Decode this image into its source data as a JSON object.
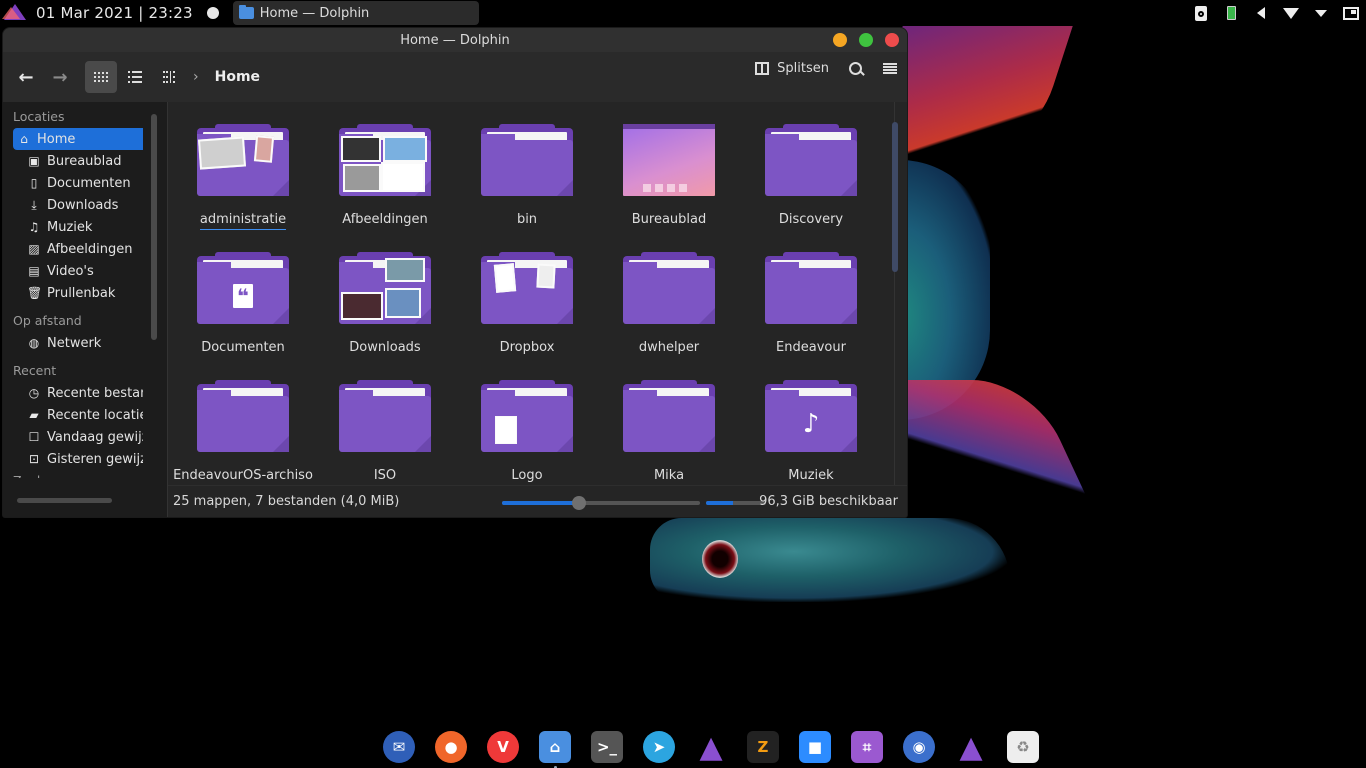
{
  "top_panel": {
    "clock": "01 Mar 2021 | 23:23",
    "task": {
      "label": "Home — Dolphin"
    },
    "tray": [
      "disk-icon",
      "battery-icon",
      "volume-icon",
      "wifi-icon",
      "tray-expand-icon",
      "show-desktop-icon"
    ]
  },
  "window": {
    "title": "Home — Dolphin",
    "buttons": {
      "minimize_color": "#f5a623",
      "maximize_color": "#3fc33f",
      "close_color": "#ee4c4c"
    },
    "toolbar": {
      "back_glyph": "←",
      "forward_glyph": "→",
      "breadcrumb_sep": "›",
      "breadcrumb": "Home",
      "split_label": "Splitsen"
    },
    "sidebar": {
      "sections": [
        {
          "title": "Locaties",
          "items": [
            {
              "label": "Home",
              "icon": "home-icon",
              "glyph": "⌂",
              "active": true
            },
            {
              "label": "Bureaublad",
              "icon": "desktop-icon",
              "glyph": "▣"
            },
            {
              "label": "Documenten",
              "icon": "document-icon",
              "glyph": "▯"
            },
            {
              "label": "Downloads",
              "icon": "download-icon",
              "glyph": "⤓"
            },
            {
              "label": "Muziek",
              "icon": "music-icon",
              "glyph": "♫"
            },
            {
              "label": "Afbeeldingen",
              "icon": "image-icon",
              "glyph": "▨"
            },
            {
              "label": "Video's",
              "icon": "video-icon",
              "glyph": "▤"
            },
            {
              "label": "Prullenbak",
              "icon": "trash-icon",
              "glyph": "🗑"
            }
          ]
        },
        {
          "title": "Op afstand",
          "items": [
            {
              "label": "Netwerk",
              "icon": "network-icon",
              "glyph": "◍"
            }
          ]
        },
        {
          "title": "Recent",
          "items": [
            {
              "label": "Recente bestanden",
              "icon": "clock-icon",
              "glyph": "◷"
            },
            {
              "label": "Recente locaties",
              "icon": "recent-folder-icon",
              "glyph": "▰"
            },
            {
              "label": "Vandaag gewijzigd",
              "icon": "calendar-today-icon",
              "glyph": "☐"
            },
            {
              "label": "Gisteren gewijzigd",
              "icon": "calendar-yesterday-icon",
              "glyph": "⊡"
            }
          ]
        }
      ],
      "cut_section": "Zoeken"
    },
    "files": [
      {
        "name": "administratie",
        "kind": "folder-docs",
        "focused": true
      },
      {
        "name": "Afbeeldingen",
        "kind": "folder-pictures"
      },
      {
        "name": "bin",
        "kind": "folder"
      },
      {
        "name": "Bureaublad",
        "kind": "desktop"
      },
      {
        "name": "Discovery",
        "kind": "folder"
      },
      {
        "name": "Documenten",
        "kind": "folder-quote"
      },
      {
        "name": "Downloads",
        "kind": "folder-downloads"
      },
      {
        "name": "Dropbox",
        "kind": "folder-dropbox"
      },
      {
        "name": "dwhelper",
        "kind": "folder"
      },
      {
        "name": "Endeavour",
        "kind": "folder"
      },
      {
        "name": "EndeavourOS-archiso",
        "kind": "folder"
      },
      {
        "name": "ISO",
        "kind": "folder"
      },
      {
        "name": "Logo",
        "kind": "folder-logo"
      },
      {
        "name": "Mika",
        "kind": "folder"
      },
      {
        "name": "Muziek",
        "kind": "folder-music"
      }
    ],
    "status": {
      "summary": "25 mappen, 7 bestanden (4,0 MiB)",
      "zoom_level_fraction": 0.39,
      "disk_used_fraction": 0.45,
      "free_space": "96,3 GiB beschikbaar"
    },
    "accent": "#1e6fd9",
    "folder_color": "#7d55c4"
  },
  "dock": [
    {
      "name": "thunderbird",
      "bg": "#2f5fb8",
      "glyph": "✉"
    },
    {
      "name": "firefox",
      "bg": "#f0662a",
      "glyph": "●"
    },
    {
      "name": "vivaldi",
      "bg": "#ef3939",
      "glyph": "V"
    },
    {
      "name": "file-manager",
      "bg": "#4a8fe0",
      "glyph": "⌂",
      "active": true
    },
    {
      "name": "terminal",
      "bg": "#555",
      "glyph": ">_"
    },
    {
      "name": "telegram",
      "bg": "#2ca5e0",
      "glyph": "➤"
    },
    {
      "name": "endeavouros",
      "bg": "#7f3fbf",
      "glyph": "▲"
    },
    {
      "name": "ziggo",
      "bg": "#222",
      "glyph": "Z"
    },
    {
      "name": "zoom",
      "bg": "#2d8cff",
      "glyph": "■"
    },
    {
      "name": "crop-tool",
      "bg": "#9b59d0",
      "glyph": "⌗"
    },
    {
      "name": "toggle-app",
      "bg": "#3b6fcc",
      "glyph": "◉"
    },
    {
      "name": "endeavouros-welcome",
      "bg": "#7f3fbf",
      "glyph": "▲"
    },
    {
      "name": "trash",
      "bg": "#eee",
      "glyph": "♻"
    }
  ]
}
